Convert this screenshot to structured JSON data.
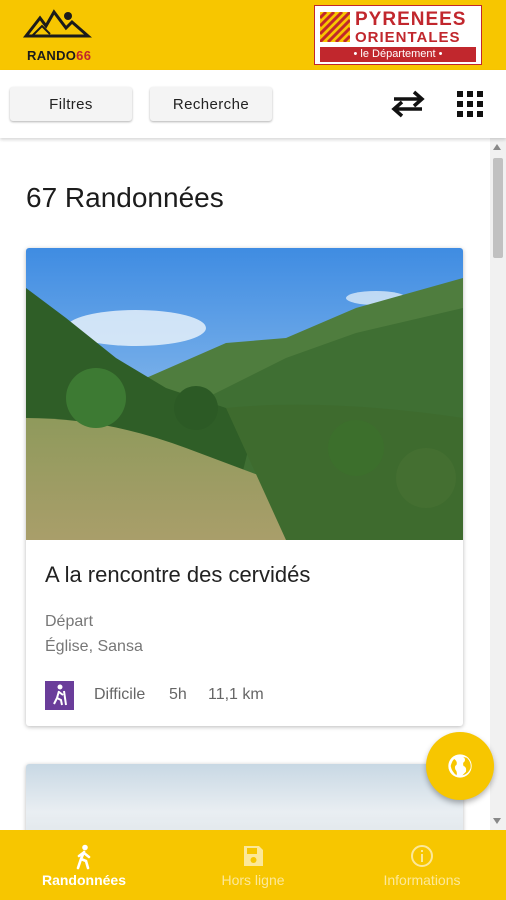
{
  "header": {
    "logo_left_text_a": "RANDO",
    "logo_left_text_b": "66",
    "logo_right_line1": "PYRENEES",
    "logo_right_line2": "ORIENTALES",
    "logo_right_line3": "• le Département •"
  },
  "toolbar": {
    "filters_label": "Filtres",
    "search_label": "Recherche",
    "swap_icon": "swap-horizontal-icon",
    "grid_icon": "grid-view-icon"
  },
  "main": {
    "count_label": "67 Randonnées",
    "hikes": [
      {
        "title": "A la rencontre des cervidés",
        "depart_label": "Départ",
        "depart_value": "Église, Sansa",
        "difficulty": "Difficile",
        "duration": "5h",
        "distance": "11,1 km",
        "difficulty_color": "#6a3d9a"
      }
    ]
  },
  "fab": {
    "icon": "globe-icon"
  },
  "bottom_nav": {
    "items": [
      {
        "label": "Randonnées",
        "icon": "hiker-icon",
        "active": true
      },
      {
        "label": "Hors ligne",
        "icon": "save-icon",
        "active": false
      },
      {
        "label": "Informations",
        "icon": "info-icon",
        "active": false
      }
    ]
  },
  "colors": {
    "brand_yellow": "#f7c600",
    "brand_red": "#c1272d"
  }
}
